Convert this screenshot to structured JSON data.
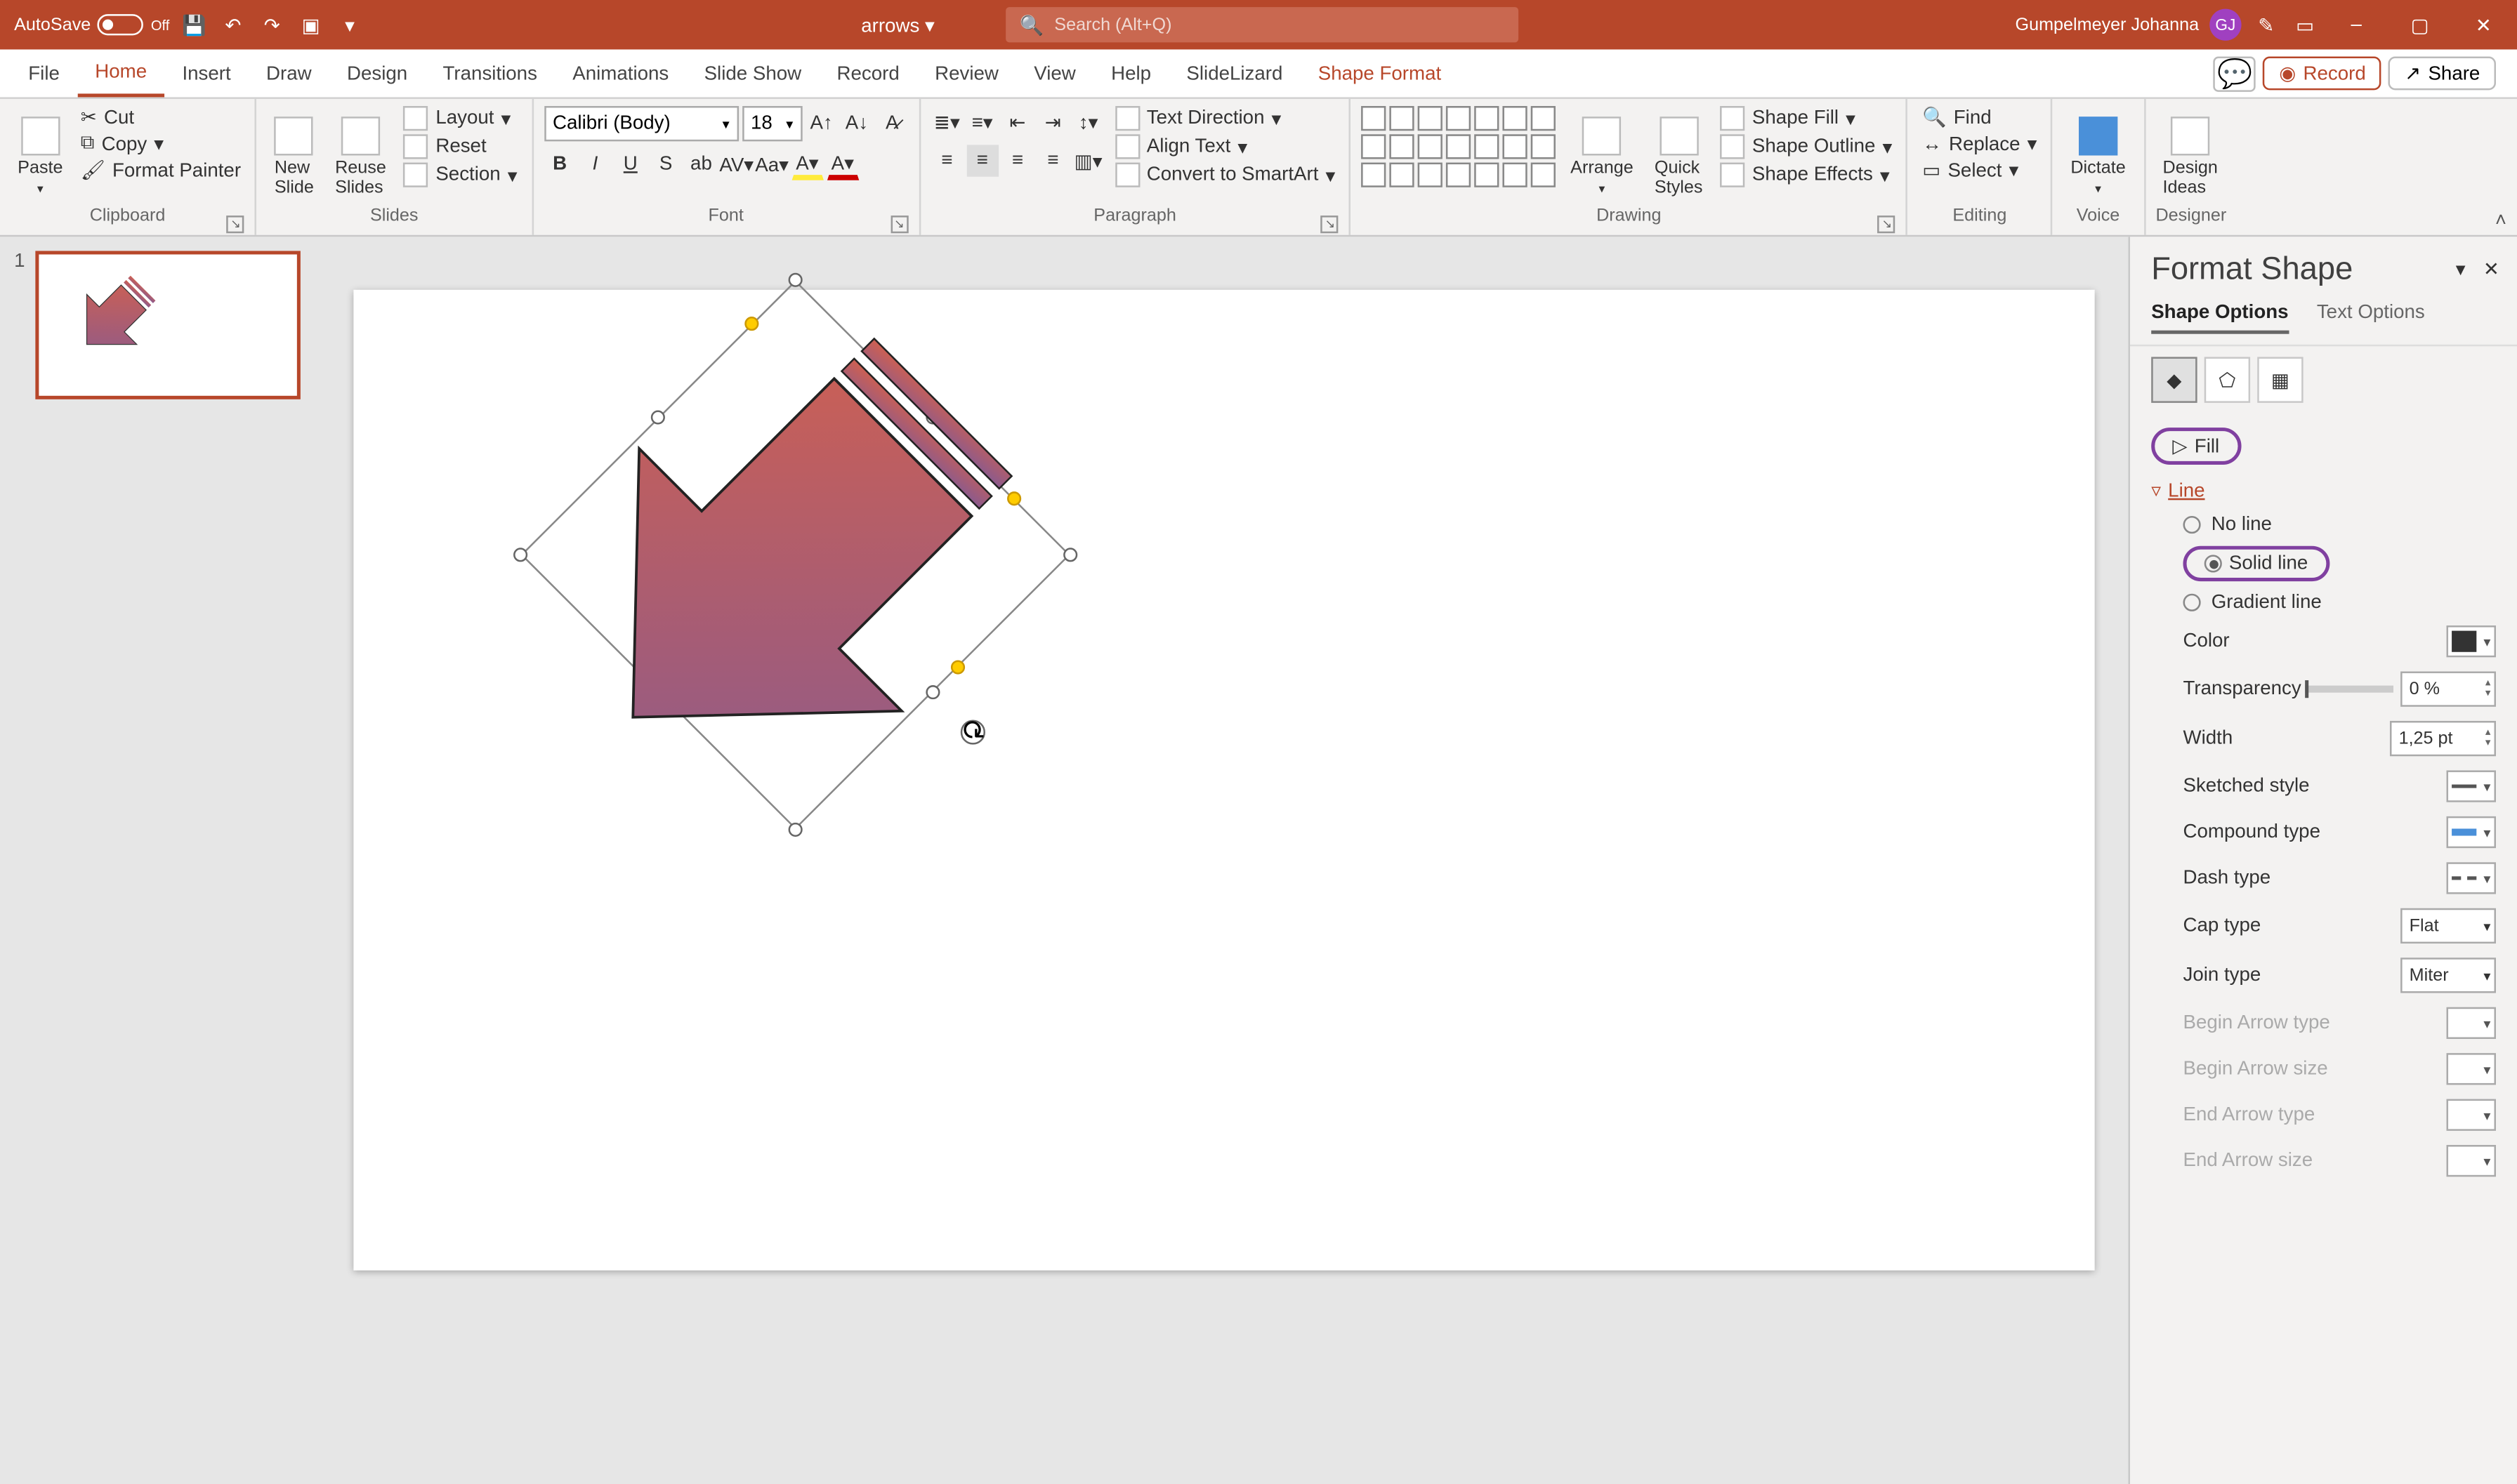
{
  "title_bar": {
    "autosave_label": "AutoSave",
    "autosave_state": "Off",
    "doc_title": "arrows",
    "search_placeholder": "Search (Alt+Q)",
    "user_name": "Gumpelmeyer Johanna",
    "user_initials": "GJ"
  },
  "ribbon_tabs": {
    "items": [
      "File",
      "Home",
      "Insert",
      "Draw",
      "Design",
      "Transitions",
      "Animations",
      "Slide Show",
      "Record",
      "Review",
      "View",
      "Help",
      "SlideLizard",
      "Shape Format"
    ],
    "active": "Home",
    "record_btn": "Record",
    "share_btn": "Share"
  },
  "ribbon": {
    "clipboard": {
      "label": "Clipboard",
      "paste": "Paste",
      "cut": "Cut",
      "copy": "Copy",
      "format_painter": "Format Painter"
    },
    "slides": {
      "label": "Slides",
      "new_slide": "New\nSlide",
      "reuse": "Reuse\nSlides",
      "layout": "Layout",
      "reset": "Reset",
      "section": "Section"
    },
    "font": {
      "label": "Font",
      "name": "Calibri (Body)",
      "size": "18"
    },
    "paragraph": {
      "label": "Paragraph",
      "text_direction": "Text Direction",
      "align_text": "Align Text",
      "smartart": "Convert to SmartArt"
    },
    "drawing": {
      "label": "Drawing",
      "arrange": "Arrange",
      "quick_styles": "Quick\nStyles",
      "shape_fill": "Shape Fill",
      "shape_outline": "Shape Outline",
      "shape_effects": "Shape Effects"
    },
    "editing": {
      "label": "Editing",
      "find": "Find",
      "replace": "Replace",
      "select": "Select"
    },
    "voice": {
      "label": "Voice",
      "dictate": "Dictate"
    },
    "designer": {
      "label": "Designer",
      "design_ideas": "Design\nIdeas"
    }
  },
  "thumbs": {
    "slide1_num": "1"
  },
  "pane": {
    "title": "Format Shape",
    "tab_shape": "Shape Options",
    "tab_text": "Text Options",
    "fill": "Fill",
    "line": "Line",
    "no_line": "No line",
    "solid_line": "Solid line",
    "gradient_line": "Gradient line",
    "color": "Color",
    "transparency": "Transparency",
    "transparency_val": "0 %",
    "width": "Width",
    "width_val": "1,25 pt",
    "sketched": "Sketched style",
    "compound": "Compound type",
    "dash": "Dash type",
    "cap": "Cap type",
    "cap_val": "Flat",
    "join": "Join type",
    "join_val": "Miter",
    "begin_arrow_type": "Begin Arrow type",
    "begin_arrow_size": "Begin Arrow size",
    "end_arrow_type": "End Arrow type",
    "end_arrow_size": "End Arrow size"
  }
}
